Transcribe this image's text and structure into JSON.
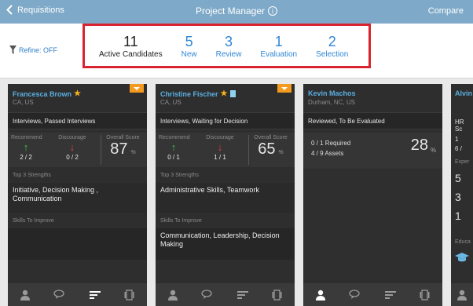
{
  "topbar": {
    "back_label": "Requisitions",
    "title": "Project Manager",
    "info_glyph": "i",
    "compare_label": "Compare"
  },
  "refine": {
    "label": "Refine: OFF"
  },
  "stats": [
    {
      "count": "11",
      "label": "Active Candidates"
    },
    {
      "count": "5",
      "label": "New"
    },
    {
      "count": "3",
      "label": "Review"
    },
    {
      "count": "1",
      "label": "Evaluation"
    },
    {
      "count": "2",
      "label": "Selection"
    }
  ],
  "cards": [
    {
      "name": "Francesca Brown",
      "location": "CA, US",
      "status": "Interviews, Passed Interviews",
      "recommend_label": "Recommend",
      "discourage_label": "Discourage",
      "score_label": "Overall Score",
      "recommend": "2 / 2",
      "discourage": "0 / 2",
      "score": "87",
      "pct": "%",
      "strengths_label": "Top 3 Strengths",
      "strengths": "Initiative, Decision Making , Communication",
      "improve_label": "Skills To Improve",
      "improve": ""
    },
    {
      "name": "Christine Fischer",
      "location": "CA, US",
      "status": "Interviews, Waiting for Decision",
      "recommend_label": "Recommend",
      "discourage_label": "Discourage",
      "score_label": "Overall Score",
      "recommend": "0 / 1",
      "discourage": "1 / 1",
      "score": "65",
      "pct": "%",
      "strengths_label": "Top 3 Strengths",
      "strengths": "Administrative Skills, Teamwork",
      "improve_label": "Skills To Improve",
      "improve": "Communication, Leadership, Decision Making"
    },
    {
      "name": "Kevin Machos",
      "location": "Durham, NC, US",
      "status": "Reviewed, To Be Evaluated",
      "required": "0 / 1  Required",
      "assets": "4 / 9  Assets",
      "score": "28",
      "pct": "%"
    },
    {
      "name": "Alvin",
      "status": "HR Sc",
      "line1": "1",
      "line2": "6 /",
      "expert": "Exper",
      "num1": "5",
      "num2": "3",
      "num3": "1",
      "edu": "Educa"
    }
  ]
}
